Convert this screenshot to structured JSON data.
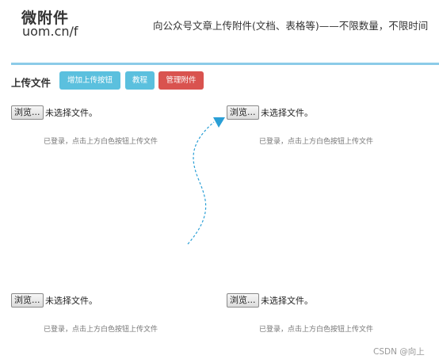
{
  "header": {
    "logo_title": "微附件",
    "logo_url": "uom.cn/f",
    "tagline": "向公众号文章上传附件(文档、表格等)——不限数量，不限时间"
  },
  "toolbar": {
    "section_title": "上传文件",
    "add_button": "增加上传按钮",
    "tutorial_button": "教程",
    "manage_button": "管理附件"
  },
  "slots": [
    {
      "browse_label": "浏览...",
      "status": "未选择文件。",
      "hint": "已登录，点击上方白色按钮上传文件"
    },
    {
      "browse_label": "浏览...",
      "status": "未选择文件。",
      "hint": "已登录，点击上方白色按钮上传文件"
    },
    {
      "browse_label": "浏览...",
      "status": "未选择文件。",
      "hint": "已登录，点击上方白色按钮上传文件"
    },
    {
      "browse_label": "浏览...",
      "status": "未选择文件。",
      "hint": "已登录，点击上方白色按钮上传文件"
    }
  ],
  "watermark": "CSDN @向上",
  "colors": {
    "accent_blue": "#5bc0de",
    "danger_red": "#d9534f",
    "divider_blue": "#8ccbe8",
    "arrow_blue": "#2a9fd6"
  },
  "icons": {
    "arrow": "curved-dashed-arrow"
  }
}
